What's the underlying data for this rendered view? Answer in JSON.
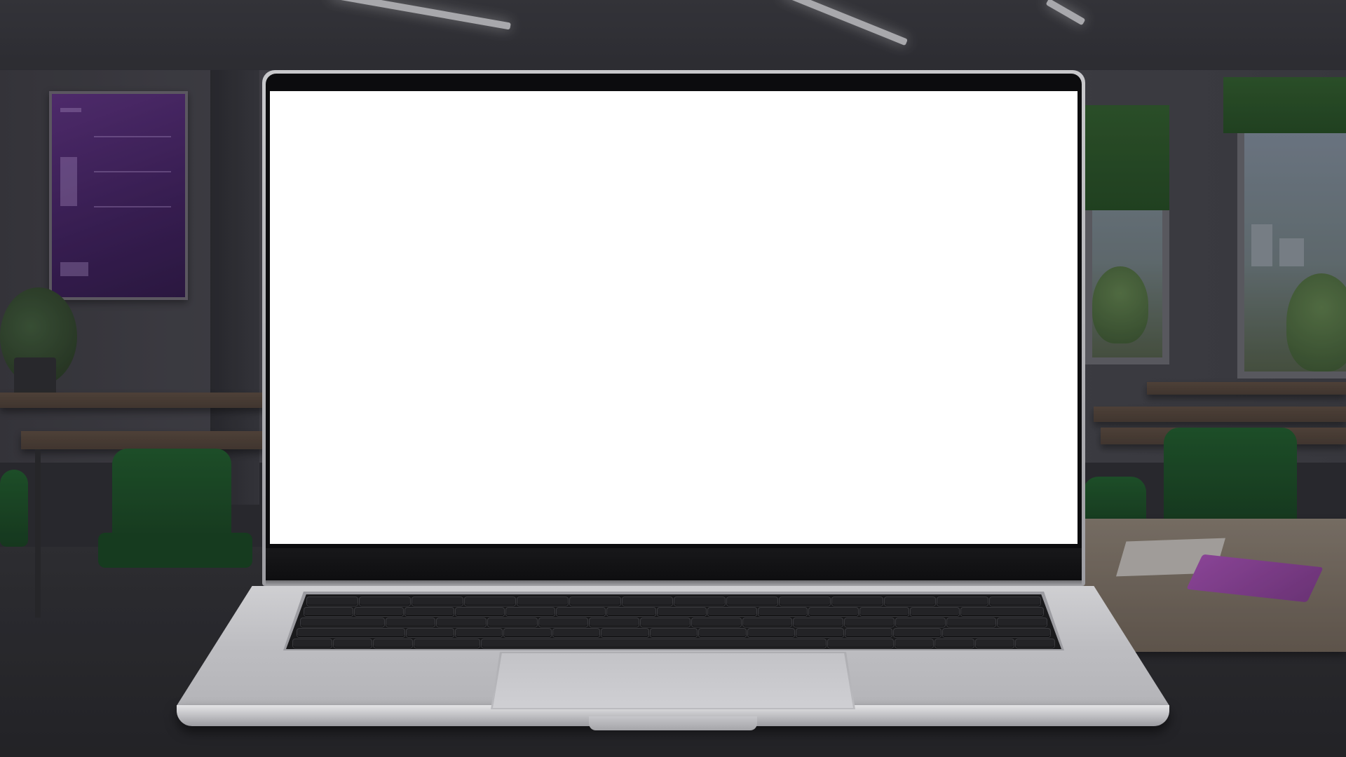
{
  "scene": {
    "description_colors": {
      "screen": "#ffffff",
      "laptop_body": "#c0c0c4",
      "keyboard": "#1a1a1c",
      "chair_green": "#1f5a2b",
      "poster_purple": "#5a2f7c",
      "folder_purple": "#a24eb0"
    }
  }
}
